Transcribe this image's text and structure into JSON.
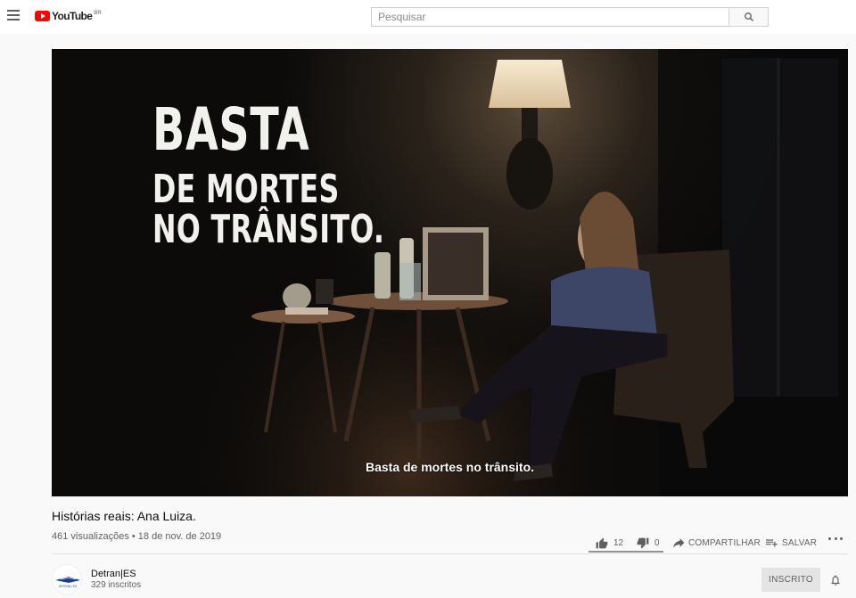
{
  "header": {
    "logo_text": "YouTube",
    "logo_country": "BR",
    "search_placeholder": "Pesquisar"
  },
  "player": {
    "overlay_title_lines": [
      "BASTA",
      "DE MORTES",
      "NO TRÂNSITO."
    ],
    "subtitle": "Basta de mortes no trânsito."
  },
  "video": {
    "title": "Histórias reais: Ana Luiza.",
    "view_info": "461 visualizações • 18 de nov. de 2019",
    "likes": "12",
    "dislikes": "0",
    "share_label": "COMPARTILHAR",
    "save_label": "SALVAR"
  },
  "channel": {
    "name": "Detran|ES",
    "subscribers": "329 inscritos",
    "subscribed_label": "INSCRITO",
    "avatar_text": "DETRAN | ES"
  },
  "colors": {
    "brand_red": "#ff0000",
    "text_primary": "#0d0d0d",
    "text_secondary": "#606060",
    "background": "#f9f9f9"
  },
  "icons": [
    "menu-icon",
    "youtube-logo-icon",
    "search-icon",
    "like-icon",
    "dislike-icon",
    "share-icon",
    "save-playlist-icon",
    "more-icon",
    "bell-icon"
  ]
}
